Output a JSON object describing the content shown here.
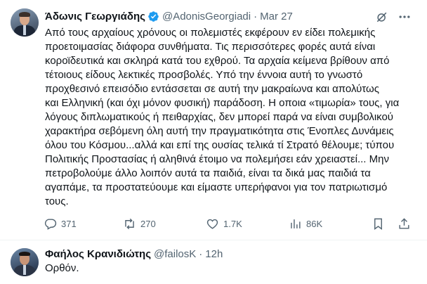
{
  "tweet": {
    "author_name": "Άδωνις Γεωργιάδης",
    "handle": "@AdonisGeorgiadi",
    "separator": "·",
    "date": "Mar 27",
    "body_lines": [
      "Από τους αρχαίους χρόνους οι πολεμιστές εκφέρουν εν είδει πολεμικής",
      "προετοιμασίας διάφορα συνθήματα. Τις περισσότερες φορές αυτά είναι",
      "κοροϊδευτικά και σκληρά κατά του εχθρού. Τα αρχαία κείμενα βρίθουν από",
      "τέτοιους είδους λεκτικές προσβολές. Υπό την έννοια αυτή το γνωστό",
      "προχθεσινό επεισόδιο εντάσσεται σε αυτή την μακραίωνα και απολύτως",
      "και Ελληνική (και όχι μόνον φυσική) παράδοση. Η οποια «τιμωρία» τους, για",
      "λόγους διπλωματικούς ή πειθαρχίας, δεν μπορεί παρά να είναι συμβολικού",
      "χαρακτήρα σεβόμενη όλη αυτή την πραγματικότητα στις Ένοπλες Δυνάμεις",
      "όλου του Κόσμου...αλλά και επί της ουσίας τελικά τί Στρατό θέλουμε; τύπου",
      "Πολιτικής Προστασίας ή αληθινά έτοιμο να πολεμήσει εάν χρειαστεί... Μην",
      "πετροβολούμε άλλο λοιπόν αυτά τα παιδιά, είναι τα δικά μας παιδιά τα",
      "αγαπάμε, τα προστατεύουμε και είμαστε υπερήφανοι για τον πατριωτισμό",
      "τους."
    ],
    "replies": "371",
    "retweets": "270",
    "likes": "1.7K",
    "views": "86K"
  },
  "reply": {
    "author_name": "Φαήλος Κρανιδιώτης",
    "handle": "@failosK",
    "separator": "·",
    "time": "12h",
    "text": "Ορθόν."
  },
  "icons": {
    "verified": "verified-badge-icon",
    "grok": "grok-icon",
    "more": "more-icon",
    "reply": "reply-icon",
    "retweet": "retweet-icon",
    "like": "heart-icon",
    "views": "views-icon",
    "bookmark": "bookmark-icon",
    "share": "share-icon"
  },
  "colors": {
    "verified": "#1d9bf0",
    "text": "#0f1419",
    "secondary": "#536471"
  }
}
